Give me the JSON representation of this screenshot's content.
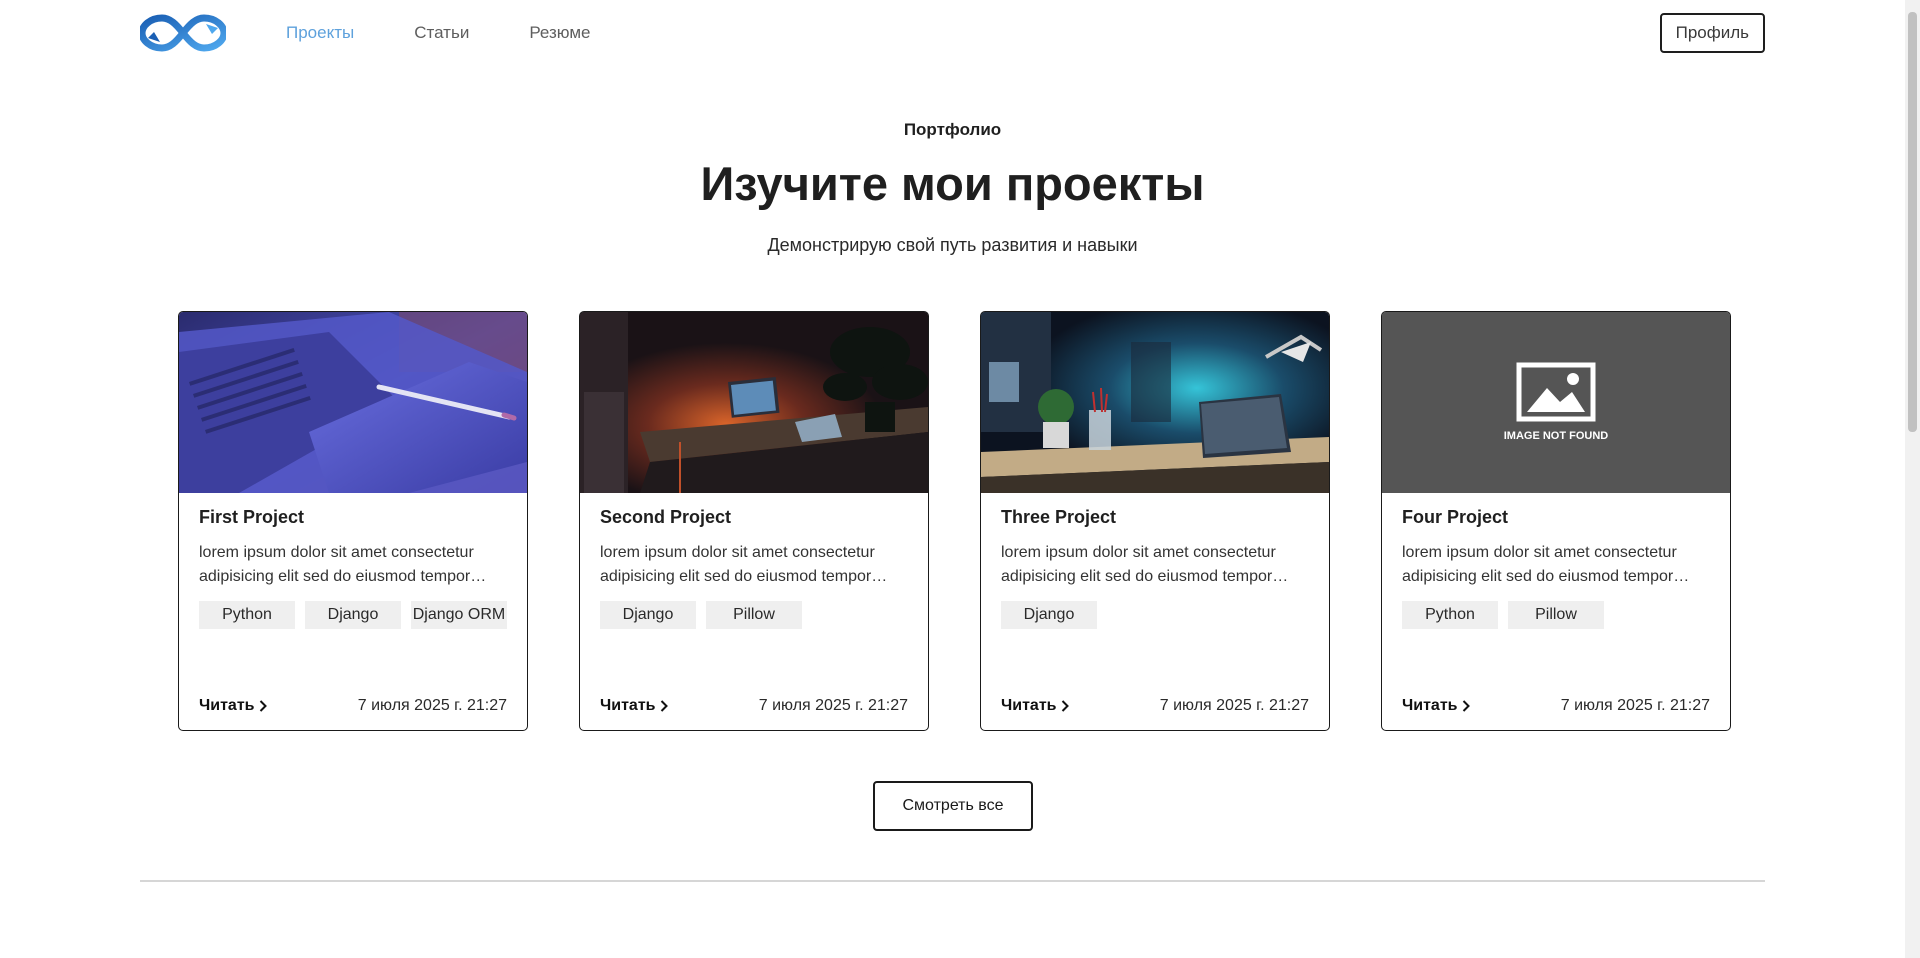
{
  "header": {
    "nav": [
      {
        "label": "Проекты",
        "active": true
      },
      {
        "label": "Статьи",
        "active": false
      },
      {
        "label": "Резюме",
        "active": false
      }
    ],
    "profile_label": "Профиль"
  },
  "hero": {
    "eyebrow": "Портфолио",
    "title": "Изучите мои проекты",
    "subtitle": "Демонстрирую свой путь развития и навыки"
  },
  "cards": [
    {
      "title": "First Project",
      "description": "lorem ipsum dolor sit amet consectetur adipisicing elit sed do eiusmod tempor incididunt",
      "tags": [
        "Python",
        "Django",
        "Django ORM"
      ],
      "read_label": "Читать",
      "date": "7 июля 2025 г. 21:27",
      "image": "laptop-tablet-purple"
    },
    {
      "title": "Second Project",
      "description": "lorem ipsum dolor sit amet consectetur adipisicing elit sed do eiusmod tempor incididunt",
      "tags": [
        "Django",
        "Pillow"
      ],
      "read_label": "Читать",
      "date": "7 июля 2025 г. 21:27",
      "image": "dark-desk-laptop"
    },
    {
      "title": "Three Project",
      "description": "lorem ipsum dolor sit amet consectetur adipisicing elit sed do eiusmod tempor incididunt",
      "tags": [
        "Django"
      ],
      "read_label": "Читать",
      "date": "7 июля 2025 г. 21:27",
      "image": "desk-lamp-blue"
    },
    {
      "title": "Four Project",
      "description": "lorem ipsum dolor sit amet consectetur adipisicing elit sed do eiusmod tempor incididunt",
      "tags": [
        "Python",
        "Pillow"
      ],
      "read_label": "Читать",
      "date": "7 июля 2025 г. 21:27",
      "image": "image-not-found",
      "image_placeholder_text": "IMAGE NOT FOUND"
    }
  ],
  "view_all_label": "Смотреть все",
  "colors": {
    "nav_active": "#5ea1dc",
    "nav_default": "#5e5e5e",
    "logo_blue": "#2e87d8",
    "placeholder_bg": "#555555"
  }
}
